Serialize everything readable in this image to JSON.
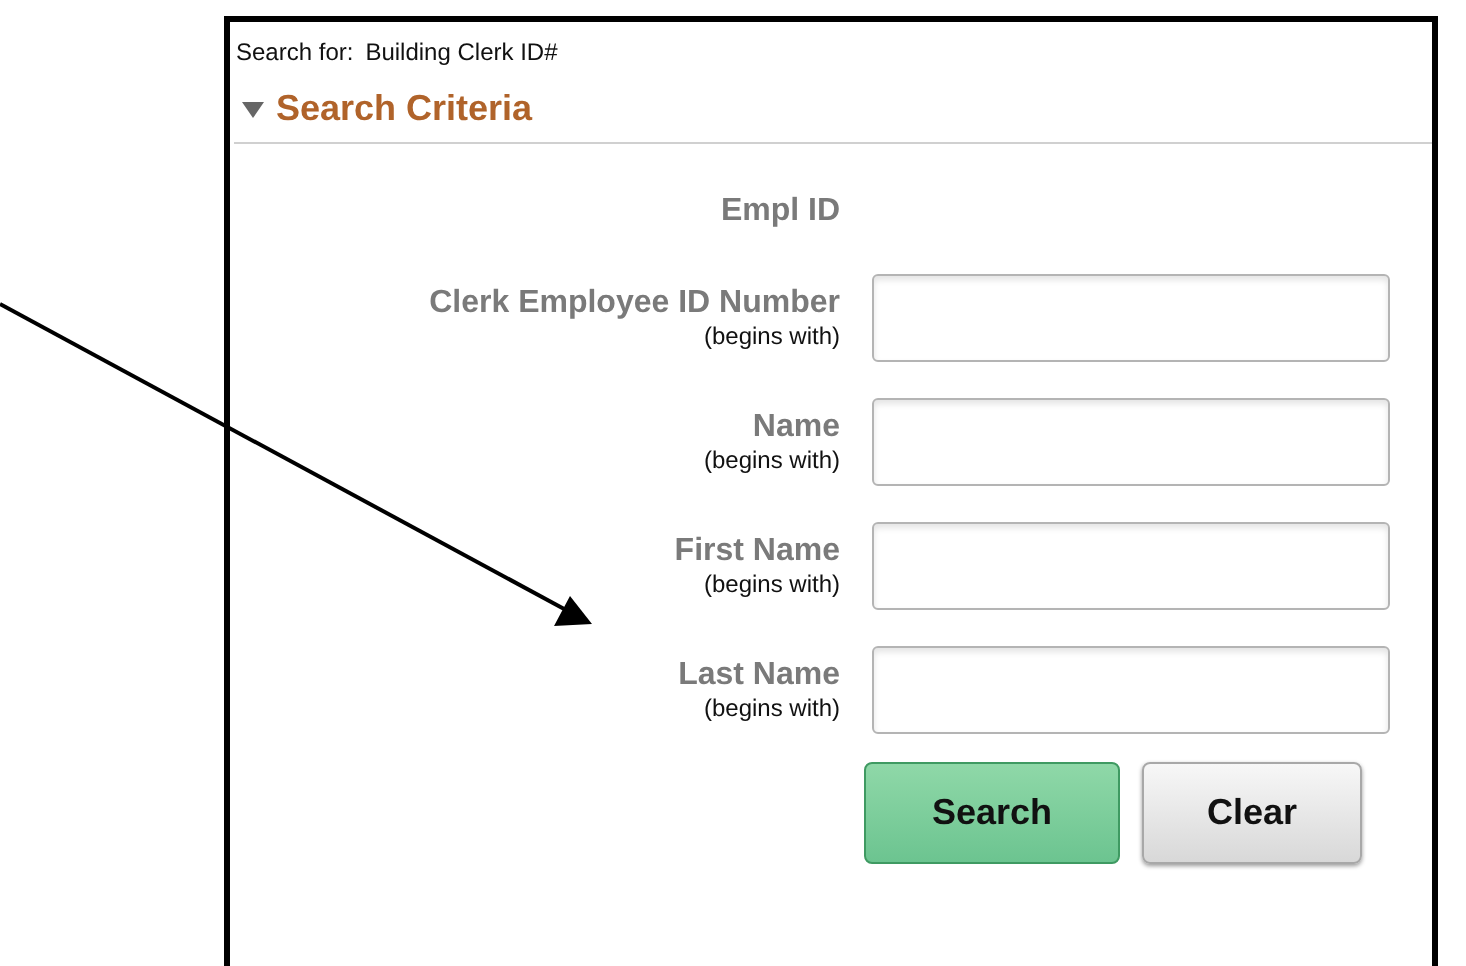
{
  "search_for": {
    "label": "Search for:",
    "value": "Building Clerk ID#"
  },
  "section": {
    "title": "Search Criteria",
    "expanded": true
  },
  "fields": [
    {
      "kind": "readonly",
      "label": "Empl ID"
    },
    {
      "kind": "text",
      "label": "Clerk Employee ID Number",
      "hint": "(begins with)"
    },
    {
      "kind": "text",
      "label": "Name",
      "hint": "(begins with)"
    },
    {
      "kind": "text",
      "label": "First Name",
      "hint": "(begins with)"
    },
    {
      "kind": "text",
      "label": "Last Name",
      "hint": "(begins with)"
    }
  ],
  "buttons": [
    {
      "label": "Search",
      "kind": "primary"
    },
    {
      "label": "Clear",
      "kind": "secondary"
    }
  ]
}
